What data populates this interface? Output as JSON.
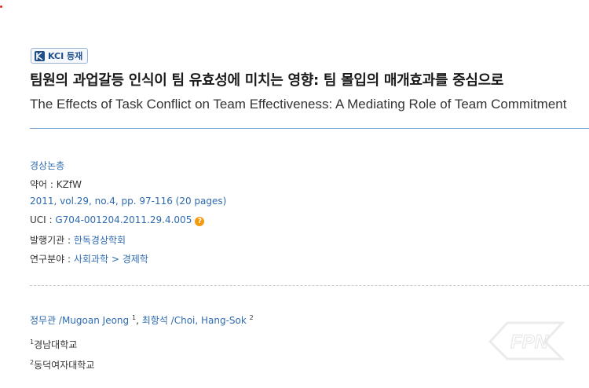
{
  "badge": {
    "label": "KCI 등재",
    "icon": "kci-icon"
  },
  "title_ko": "팀원의 과업갈등 인식이 팀 유효성에 미치는 영향: 팀 몰입의 매개효과를 중심으로",
  "title_en": "The Effects of Task Conflict on Team Effectiveness: A Mediating Role of Team Commitment",
  "journal": {
    "name": "경상논총",
    "abbr_label": "약어 : ",
    "abbr_value": "KZfW",
    "citation": "2011, vol.29, no.4, pp. 97-116 (20 pages)",
    "uci_label": "UCI : ",
    "uci_value": "G704-001204.2011.29.4.005",
    "publisher_label": "발행기관 : ",
    "publisher_value": "한독경상학회",
    "field_label": "연구분야 : ",
    "field_value": "사회과학 > 경제학"
  },
  "authors": [
    {
      "name": "정무관 /Mugoan Jeong",
      "sup": "1"
    },
    {
      "name": "최항석 /Choi, Hang-Sok",
      "sup": "2"
    }
  ],
  "author_separator": ",",
  "affiliations": [
    {
      "sup": "1",
      "name": "경남대학교"
    },
    {
      "sup": "2",
      "name": "동덕여자대학교"
    }
  ],
  "watermark_text": "FPN",
  "colors": {
    "link": "#2e6bb0",
    "rule": "#7aa6cf",
    "help": "#f39c12",
    "badge_text": "#1f4e8c"
  }
}
